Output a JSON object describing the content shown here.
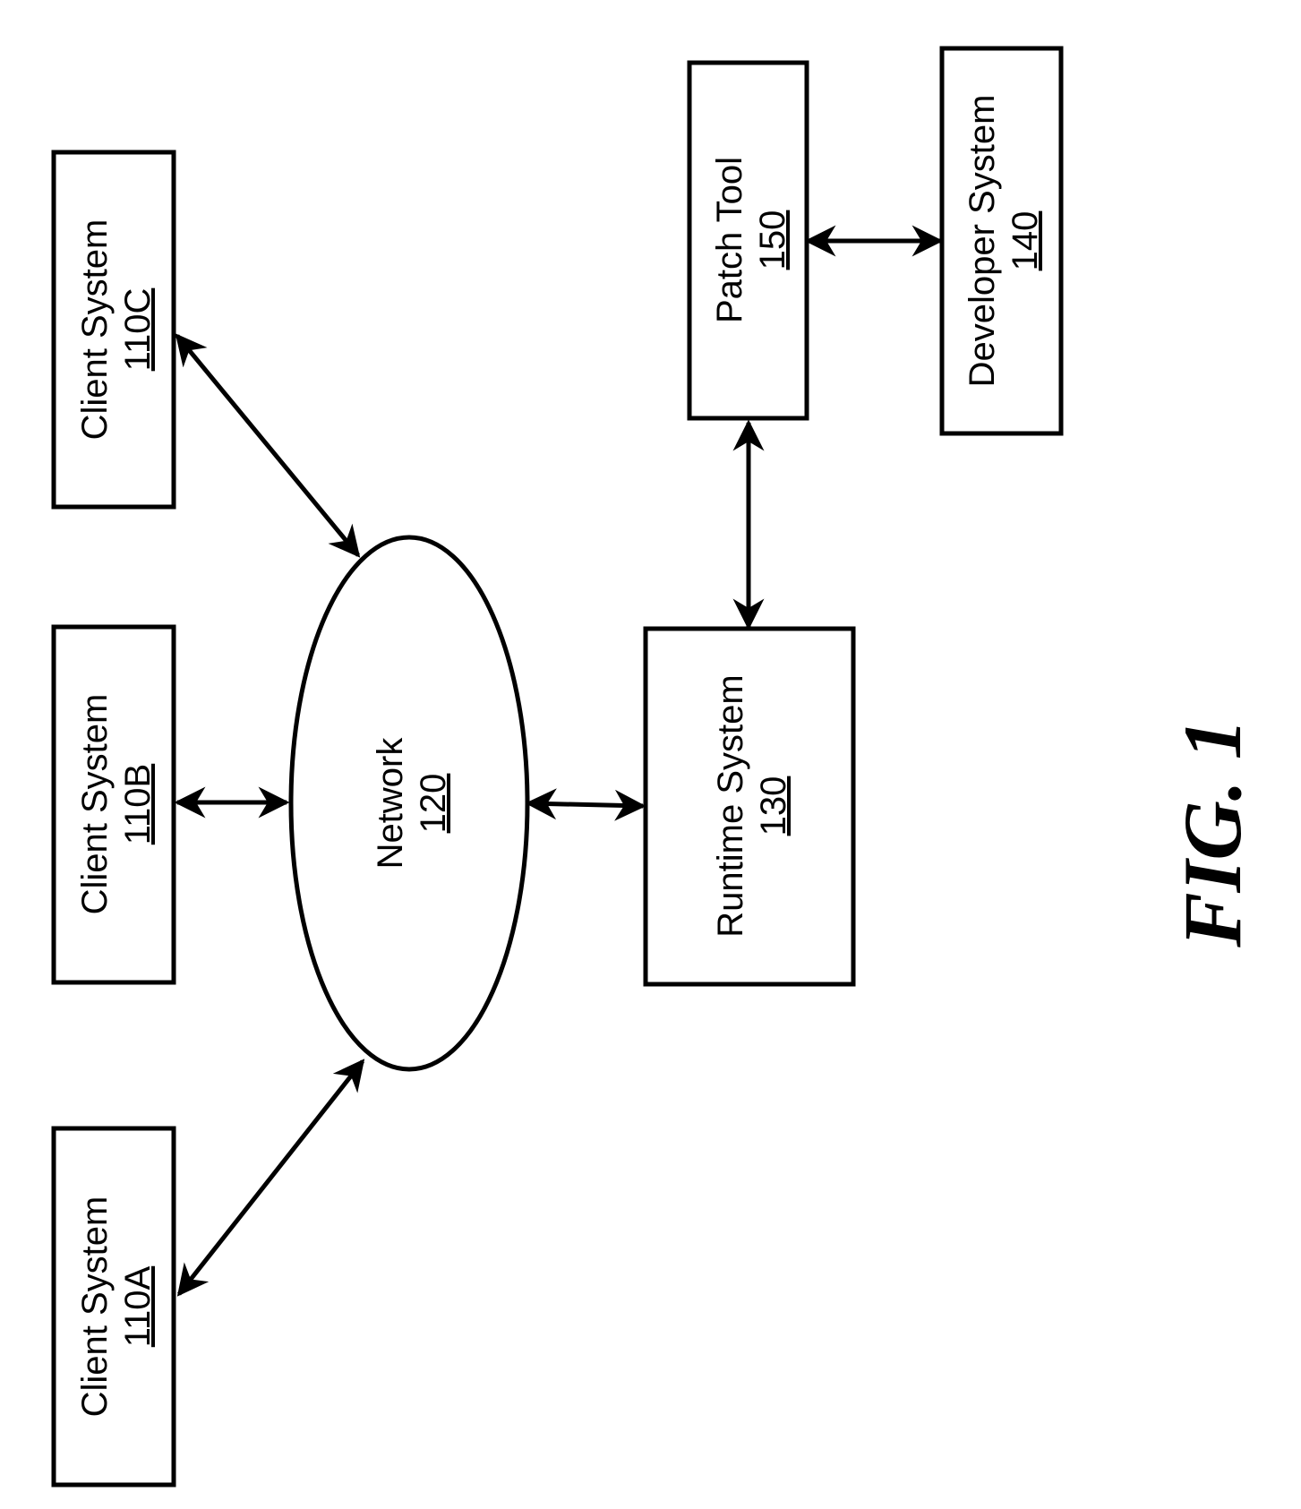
{
  "figure": {
    "caption": "FIG. 1",
    "orientation": "rotated 90° counter-clockwise"
  },
  "nodes": [
    {
      "id": "client_a",
      "label": "Client System",
      "ref": "110A"
    },
    {
      "id": "client_b",
      "label": "Client System",
      "ref": "110B"
    },
    {
      "id": "client_c",
      "label": "Client System",
      "ref": "110C"
    },
    {
      "id": "network",
      "label": "Network",
      "ref": "120"
    },
    {
      "id": "runtime",
      "label": "Runtime System",
      "ref": "130"
    },
    {
      "id": "patch_tool",
      "label": "Patch Tool",
      "ref": "150"
    },
    {
      "id": "developer",
      "label": "Developer System",
      "ref": "140"
    }
  ],
  "edges": [
    {
      "from": "client_a",
      "to": "network",
      "direction": "bidirectional"
    },
    {
      "from": "client_b",
      "to": "network",
      "direction": "bidirectional"
    },
    {
      "from": "client_c",
      "to": "network",
      "direction": "bidirectional"
    },
    {
      "from": "network",
      "to": "runtime",
      "direction": "bidirectional"
    },
    {
      "from": "runtime",
      "to": "patch_tool",
      "direction": "bidirectional"
    },
    {
      "from": "patch_tool",
      "to": "developer",
      "direction": "bidirectional"
    }
  ]
}
